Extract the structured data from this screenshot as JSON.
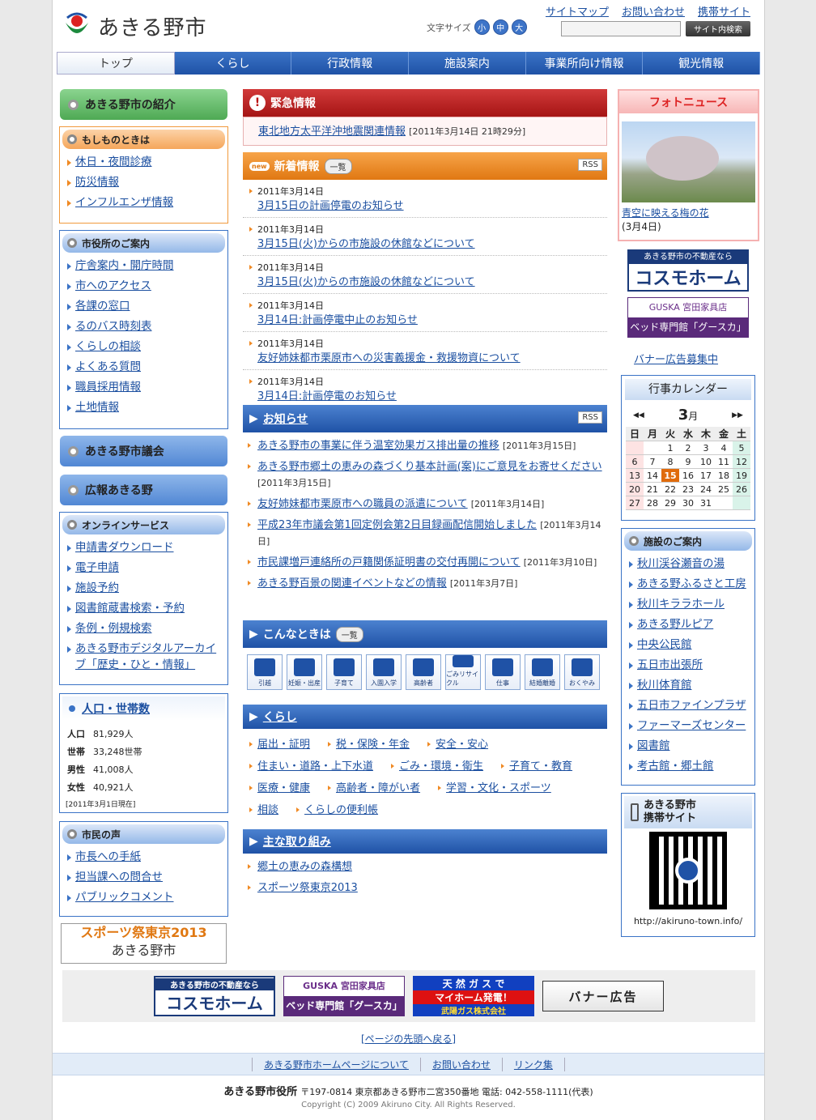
{
  "header": {
    "site_title": "あきる野市",
    "fontsize_label": "文字サイズ",
    "fontsize": [
      "小",
      "中",
      "大"
    ],
    "links": [
      "サイトマップ",
      "お問い合わせ",
      "携帯サイト"
    ],
    "search_placeholder": "",
    "search_button": "サイト内検索"
  },
  "nav": [
    "トップ",
    "くらし",
    "行政情報",
    "施設案内",
    "事業所向け情報",
    "観光情報"
  ],
  "left": {
    "intro": "あきる野市の紹介",
    "emergency": {
      "title": "もしものときは",
      "items": [
        "休日・夜間診療",
        "防災情報",
        "インフルエンザ情報"
      ]
    },
    "cityhall": {
      "title": "市役所のご案内",
      "items": [
        "庁舎案内・開庁時間",
        "市へのアクセス",
        "各課の窓口",
        "るのバス時刻表",
        "くらしの相談",
        "よくある質問",
        "職員採用情報",
        "土地情報"
      ]
    },
    "assembly": "あきる野市議会",
    "koho": "広報あきる野",
    "online": {
      "title": "オンラインサービス",
      "items": [
        "申請書ダウンロード",
        "電子申請",
        "施設予約",
        "図書館蔵書検索・予約",
        "条例・例規検索",
        "あきる野市デジタルアーカイブ「歴史・ひと・情報」"
      ]
    },
    "population": {
      "title": "人口・世帯数",
      "rows": [
        [
          "人口",
          "81,929人"
        ],
        [
          "世帯",
          "33,248世帯"
        ],
        [
          "男性",
          "41,008人"
        ],
        [
          "女性",
          "40,921人"
        ]
      ],
      "note": "[2011年3月1日現在]"
    },
    "voice": {
      "title": "市民の声",
      "items": [
        "市長への手紙",
        "担当課への問合せ",
        "パブリックコメント"
      ]
    },
    "sports_banner": [
      "スポーツ祭東京2013",
      "あきる野市"
    ]
  },
  "center": {
    "urgent": {
      "title": "緊急情報",
      "link": "東北地方太平洋沖地震関連情報",
      "date": "[2011年3月14日 21時29分]"
    },
    "new": {
      "title": "新着情報",
      "list_btn": "一覧",
      "rss": "RSS",
      "items": [
        {
          "date": "2011年3月14日",
          "title": "3月15日の計画停電のお知らせ"
        },
        {
          "date": "2011年3月14日",
          "title": "3月15日(火)からの市施設の休館などについて"
        },
        {
          "date": "2011年3月14日",
          "title": "3月15日(火)からの市施設の休館などについて"
        },
        {
          "date": "2011年3月14日",
          "title": "3月14日:計画停電中止のお知らせ"
        },
        {
          "date": "2011年3月14日",
          "title": "友好姉妹都市栗原市への災害義援金・救援物資について"
        },
        {
          "date": "2011年3月14日",
          "title": "3月14日:計画停電のお知らせ"
        }
      ]
    },
    "notice": {
      "title": "お知らせ",
      "rss": "RSS",
      "items": [
        {
          "title": "あきる野市の事業に伴う温室効果ガス排出量の推移",
          "date": "[2011年3月15日]"
        },
        {
          "title": "あきる野市郷土の恵みの森づくり基本計画(案)にご意見をお寄せください",
          "date": "[2011年3月15日]"
        },
        {
          "title": "友好姉妹都市栗原市への職員の派遣について",
          "date": "[2011年3月14日]"
        },
        {
          "title": "平成23年市議会第1回定例会第2日目録画配信開始しました",
          "date": "[2011年3月14日]"
        },
        {
          "title": "市民課増戸連絡所の戸籍関係証明書の交付再開について",
          "date": "[2011年3月10日]"
        },
        {
          "title": "あきる野百景の関連イベントなどの情報",
          "date": "[2011年3月7日]"
        }
      ]
    },
    "situations": {
      "title": "こんなときは",
      "list_btn": "一覧",
      "icons": [
        "引越",
        "妊娠・出産",
        "子育て",
        "入園入学",
        "高齢者",
        "ごみリサイクル",
        "仕事",
        "結婚離婚",
        "おくやみ"
      ]
    },
    "kurashi": {
      "title": "くらし",
      "items": [
        "届出・証明",
        "税・保険・年金",
        "安全・安心",
        "住まい・道路・上下水道",
        "ごみ・環境・衛生",
        "子育て・教育",
        "医療・健康",
        "高齢者・障がい者",
        "学習・文化・スポーツ",
        "相談",
        "くらしの便利帳"
      ]
    },
    "main": {
      "title": "主な取り組み",
      "items": [
        "郷土の恵みの森構想",
        "スポーツ祭東京2013"
      ]
    }
  },
  "right": {
    "photo": {
      "title": "フォトニュース",
      "caption": "青空に映える梅の花",
      "date": "(3月4日)"
    },
    "ad1": {
      "line1": "あきる野市の不動産なら",
      "line2": "コスモホーム"
    },
    "ad2": {
      "line1": "GUSKA 宮田家具店",
      "line2": "ベッド専門館「グースカ」"
    },
    "banner_recruit": "バナー広告募集中",
    "calendar": {
      "title": "行事カレンダー",
      "month": "3",
      "month_unit": "月",
      "prev": "◀◀",
      "next": "▶▶",
      "weekdays": [
        "日",
        "月",
        "火",
        "水",
        "木",
        "金",
        "土"
      ],
      "weeks": [
        [
          "",
          "",
          "1",
          "2",
          "3",
          "4",
          "5"
        ],
        [
          "6",
          "7",
          "8",
          "9",
          "10",
          "11",
          "12"
        ],
        [
          "13",
          "14",
          "15",
          "16",
          "17",
          "18",
          "19"
        ],
        [
          "20",
          "21",
          "22",
          "23",
          "24",
          "25",
          "26"
        ],
        [
          "27",
          "28",
          "29",
          "30",
          "31",
          "",
          ""
        ]
      ],
      "today": "15"
    },
    "facilities": {
      "title": "施設のご案内",
      "items": [
        "秋川渓谷瀬音の湯",
        "あきる野ふるさと工房",
        "秋川キララホール",
        "あきる野ルピア",
        "中央公民館",
        "五日市出張所",
        "秋川体育館",
        "五日市ファインプラザ",
        "ファーマーズセンター",
        "図書館",
        "考古館・郷土館"
      ]
    },
    "mobile": {
      "title1": "あきる野市",
      "title2": "携帯サイト",
      "url": "http://akiruno-town.info/"
    }
  },
  "footer": {
    "banners": [
      [
        "あきる野市の不動産なら",
        "コスモホーム"
      ],
      [
        "GUSKA 宮田家具店",
        "ベッド専門館「グースカ」"
      ],
      [
        "天 然 ガ ス で",
        "マイホーム発電！",
        "武陽ガス株式会社"
      ],
      [
        "バナー広告"
      ]
    ],
    "totop": "[ページの先頭へ戻る]",
    "links": [
      "あきる野市ホームページについて",
      "お問い合わせ",
      "リンク集"
    ],
    "office": "あきる野市役所",
    "address": "〒197-0814 東京都あきる野市二宮350番地  電話: 042-558-1111(代表)",
    "copyright": "Copyright (C) 2009 Akiruno City. All Rights Reserved."
  }
}
